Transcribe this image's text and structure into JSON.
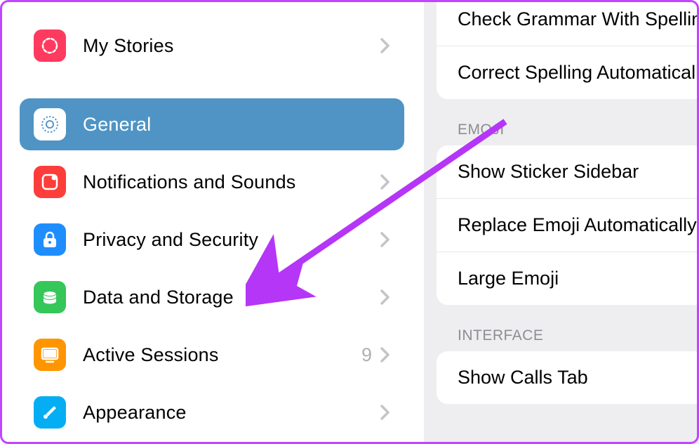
{
  "sidebar": {
    "items": [
      {
        "id": "my-stories",
        "label": "My Stories",
        "icon": "stories-icon",
        "color": "#ff3a5f",
        "selected": false,
        "value": null
      },
      {
        "id": "general",
        "label": "General",
        "icon": "gear-icon",
        "color": "#5399cd",
        "selected": true,
        "value": null
      },
      {
        "id": "notifications",
        "label": "Notifications and Sounds",
        "icon": "bell-icon",
        "color": "#fd3d39",
        "selected": false,
        "value": null
      },
      {
        "id": "privacy",
        "label": "Privacy and Security",
        "icon": "lock-icon",
        "color": "#1e8efe",
        "selected": false,
        "value": null
      },
      {
        "id": "storage",
        "label": "Data and Storage",
        "icon": "storage-icon",
        "color": "#35c759",
        "selected": false,
        "value": null
      },
      {
        "id": "sessions",
        "label": "Active Sessions",
        "icon": "sessions-icon",
        "color": "#ff9501",
        "selected": false,
        "value": "9"
      },
      {
        "id": "appearance",
        "label": "Appearance",
        "icon": "brush-icon",
        "color": "#05aef3",
        "selected": false,
        "value": null
      }
    ]
  },
  "rightPanel": {
    "groups": [
      {
        "header": null,
        "rows": [
          {
            "label": "Check Grammar With Spelling"
          },
          {
            "label": "Correct Spelling Automatically"
          }
        ]
      },
      {
        "header": "EMOJI",
        "rows": [
          {
            "label": "Show Sticker Sidebar"
          },
          {
            "label": "Replace Emoji Automatically"
          },
          {
            "label": "Large Emoji"
          }
        ]
      },
      {
        "header": "INTERFACE",
        "rows": [
          {
            "label": "Show Calls Tab"
          }
        ]
      }
    ]
  },
  "annotation": {
    "arrowColor": "#b536f7"
  }
}
